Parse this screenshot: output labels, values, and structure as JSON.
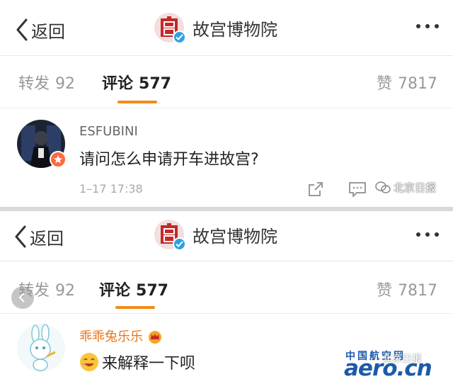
{
  "screens": [
    {
      "header": {
        "back_label": "返回",
        "account_name": "故宫博物院"
      },
      "tabs": {
        "repost_label": "转发",
        "repost_count": "92",
        "comments_label": "评论",
        "comments_count": "577",
        "likes_label": "赞",
        "likes_count": "7817"
      },
      "comment": {
        "username": "ESFUBINI",
        "text": "请问怎么申请开车进故宫?",
        "time": "1–17 17:38"
      }
    },
    {
      "header": {
        "back_label": "返回",
        "account_name": "故宫博物院"
      },
      "tabs": {
        "repost_label": "转发",
        "repost_count": "92",
        "comments_label": "评论",
        "comments_count": "577",
        "likes_label": "赞",
        "likes_count": "7817"
      },
      "comment": {
        "username": "乖乖兔乐乐",
        "text": "来解释一下呗"
      }
    }
  ],
  "watermarks": {
    "beijing_daily": "北京日报",
    "aero_cn_top": "中国航空网",
    "aero_cn_logo": "aero.cn",
    "beijing_daily_2": "北京日报"
  },
  "colors": {
    "accent": "#f28b1a",
    "verified": "#2fa1e3",
    "badge": "#ff6a3c",
    "aero_blue": "#1d5aa8"
  },
  "icons": [
    "chevron-left-icon",
    "verified-icon",
    "more-icon",
    "share-icon",
    "comment-icon",
    "wechat-icon",
    "vip-crown-icon",
    "smile-emoji-icon"
  ]
}
